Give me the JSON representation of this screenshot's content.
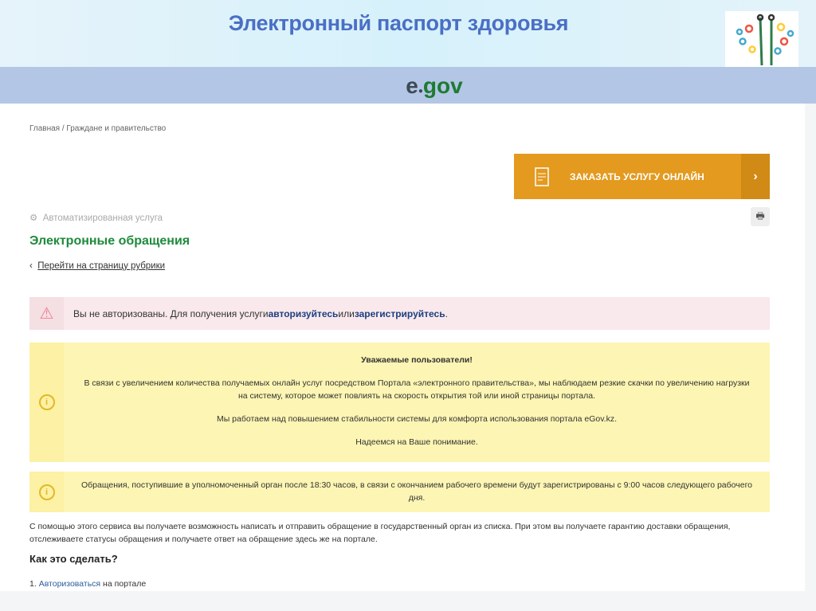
{
  "slide": {
    "title": "Электронный паспорт здоровья",
    "logo_text": "e.gov"
  },
  "breadcrumb": "Главная / Граждане и правительство",
  "order_button": {
    "label": "ЗАКАЗАТЬ УСЛУГУ ОНЛАЙН",
    "arrow": "›"
  },
  "service_type": "Автоматизированная услуга",
  "page_title": "Электронные обращения",
  "back_link": "Перейти на страницу рубрики",
  "alert": {
    "text1": "Вы не авторизованы. Для получения услуги ",
    "link1": "авторизуйтесь",
    "text2": " или ",
    "link2": "зарегистрируйтесь",
    "text3": "."
  },
  "notice1": {
    "heading": "Уважаемые пользователи!",
    "p1": "В связи с увеличением количества получаемых онлайн услуг посредством Портала «электронного правительства», мы наблюдаем резкие скачки по увеличению нагрузки на систему, которое может повлиять на скорость открытия той или иной страницы портала.",
    "p2": "Мы работаем над повышением стабильности системы для комфорта использования портала eGov.kz.",
    "p3": "Надеемся на Ваше понимание."
  },
  "notice2": "Обращения, поступившие в уполномоченный орган после 18:30 часов, в связи с окончанием рабочего времени будут зарегистрированы с 9:00 часов следующего рабочего дня.",
  "description": "С помощью этого сервиса вы получаете возможность написать и отправить обращение в государственный орган из списка. При этом вы получаете гарантию доставки обращения, отслеживаете статусы обращения и получаете ответ на обращение здесь же на портале.",
  "how_heading": "Как это сделать?",
  "steps": [
    {
      "num": "1.",
      "link": "Авторизоваться",
      "text": " на портале"
    }
  ]
}
